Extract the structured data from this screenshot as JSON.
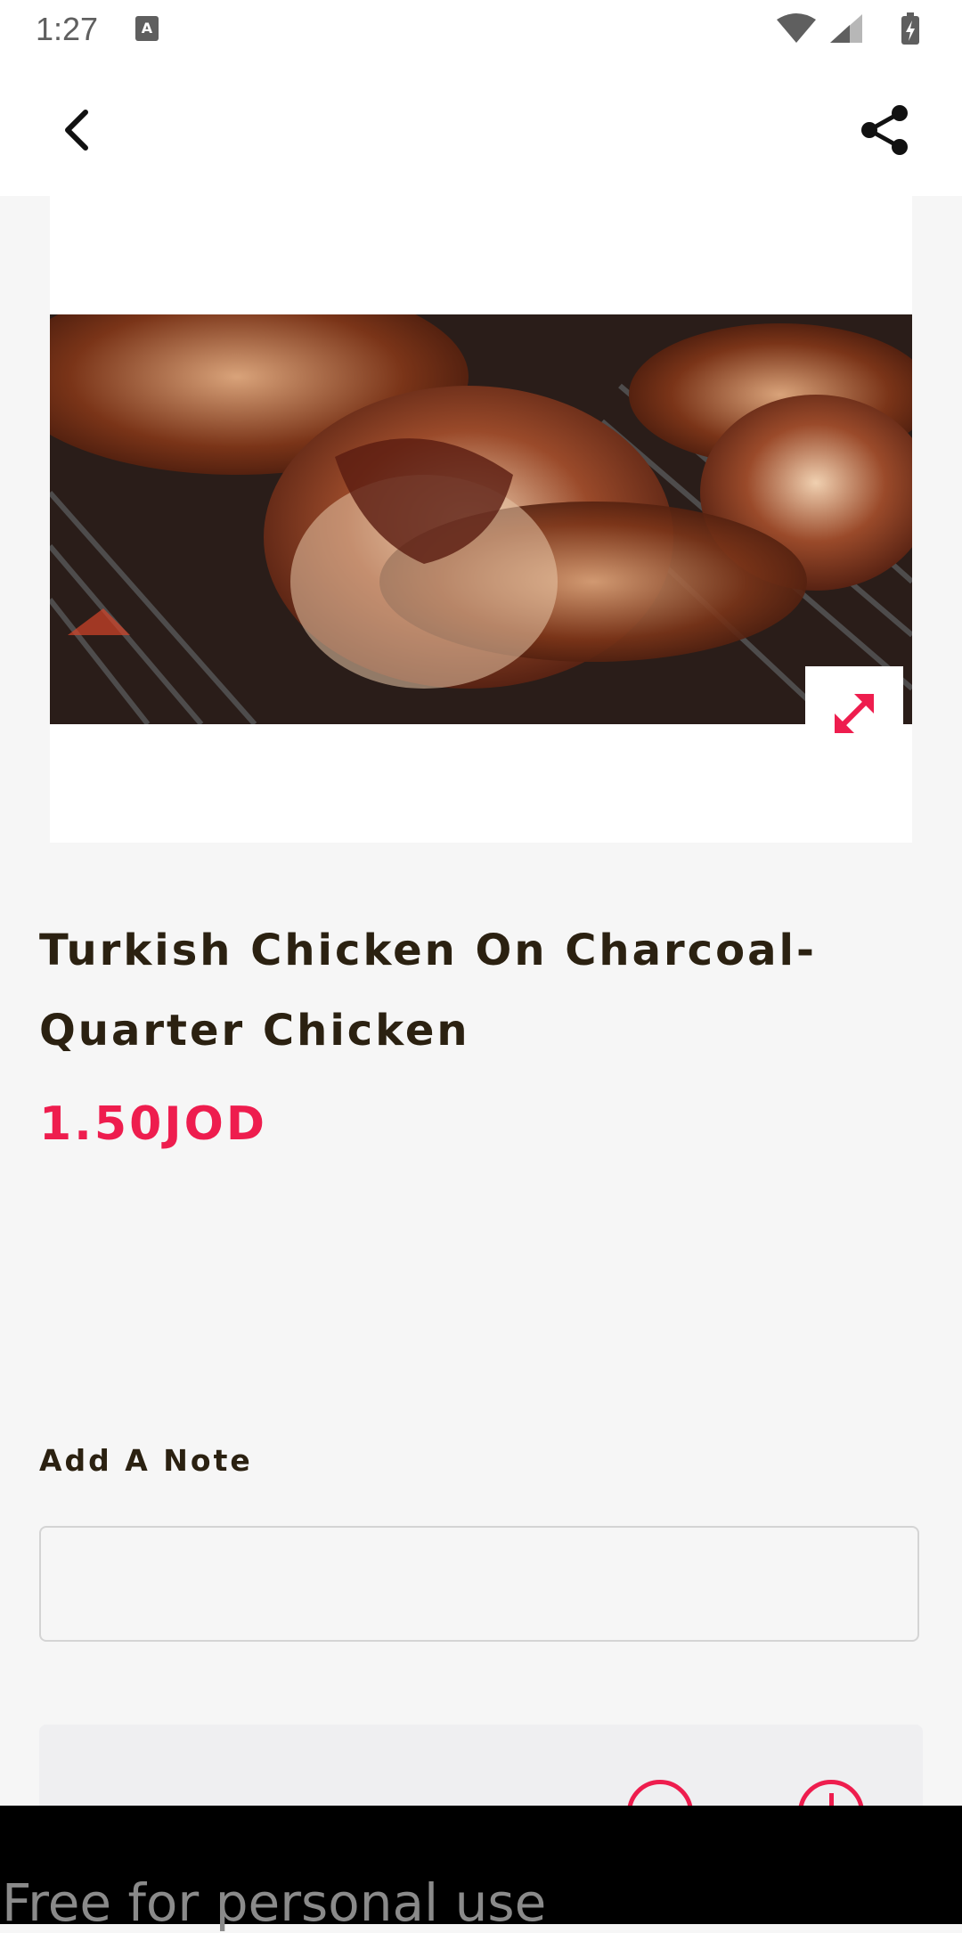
{
  "status_bar": {
    "time": "1:27",
    "icons": [
      "a-notification-icon",
      "wifi-icon",
      "signal-icon",
      "battery-icon"
    ]
  },
  "toolbar": {
    "back_icon": "chevron-left-icon",
    "share_icon": "share-icon"
  },
  "item": {
    "title": "Turkish Chicken On Charcoal- Quarter Chicken",
    "price": "1.50JOD",
    "image_alt": "grilled chicken drumsticks on charcoal grill",
    "expand_icon": "expand-arrows-icon"
  },
  "note": {
    "label": "Add A Note",
    "value": "",
    "placeholder": ""
  },
  "quantity": {
    "decrease_icon": "minus-circle-icon",
    "increase_icon": "plus-circle-icon"
  },
  "watermark": {
    "text": "Free for personal use"
  },
  "colors": {
    "accent": "#ee1d4e",
    "title_text": "#2b2111",
    "background": "#f6f6f6",
    "toolbar": "#ffffff"
  }
}
